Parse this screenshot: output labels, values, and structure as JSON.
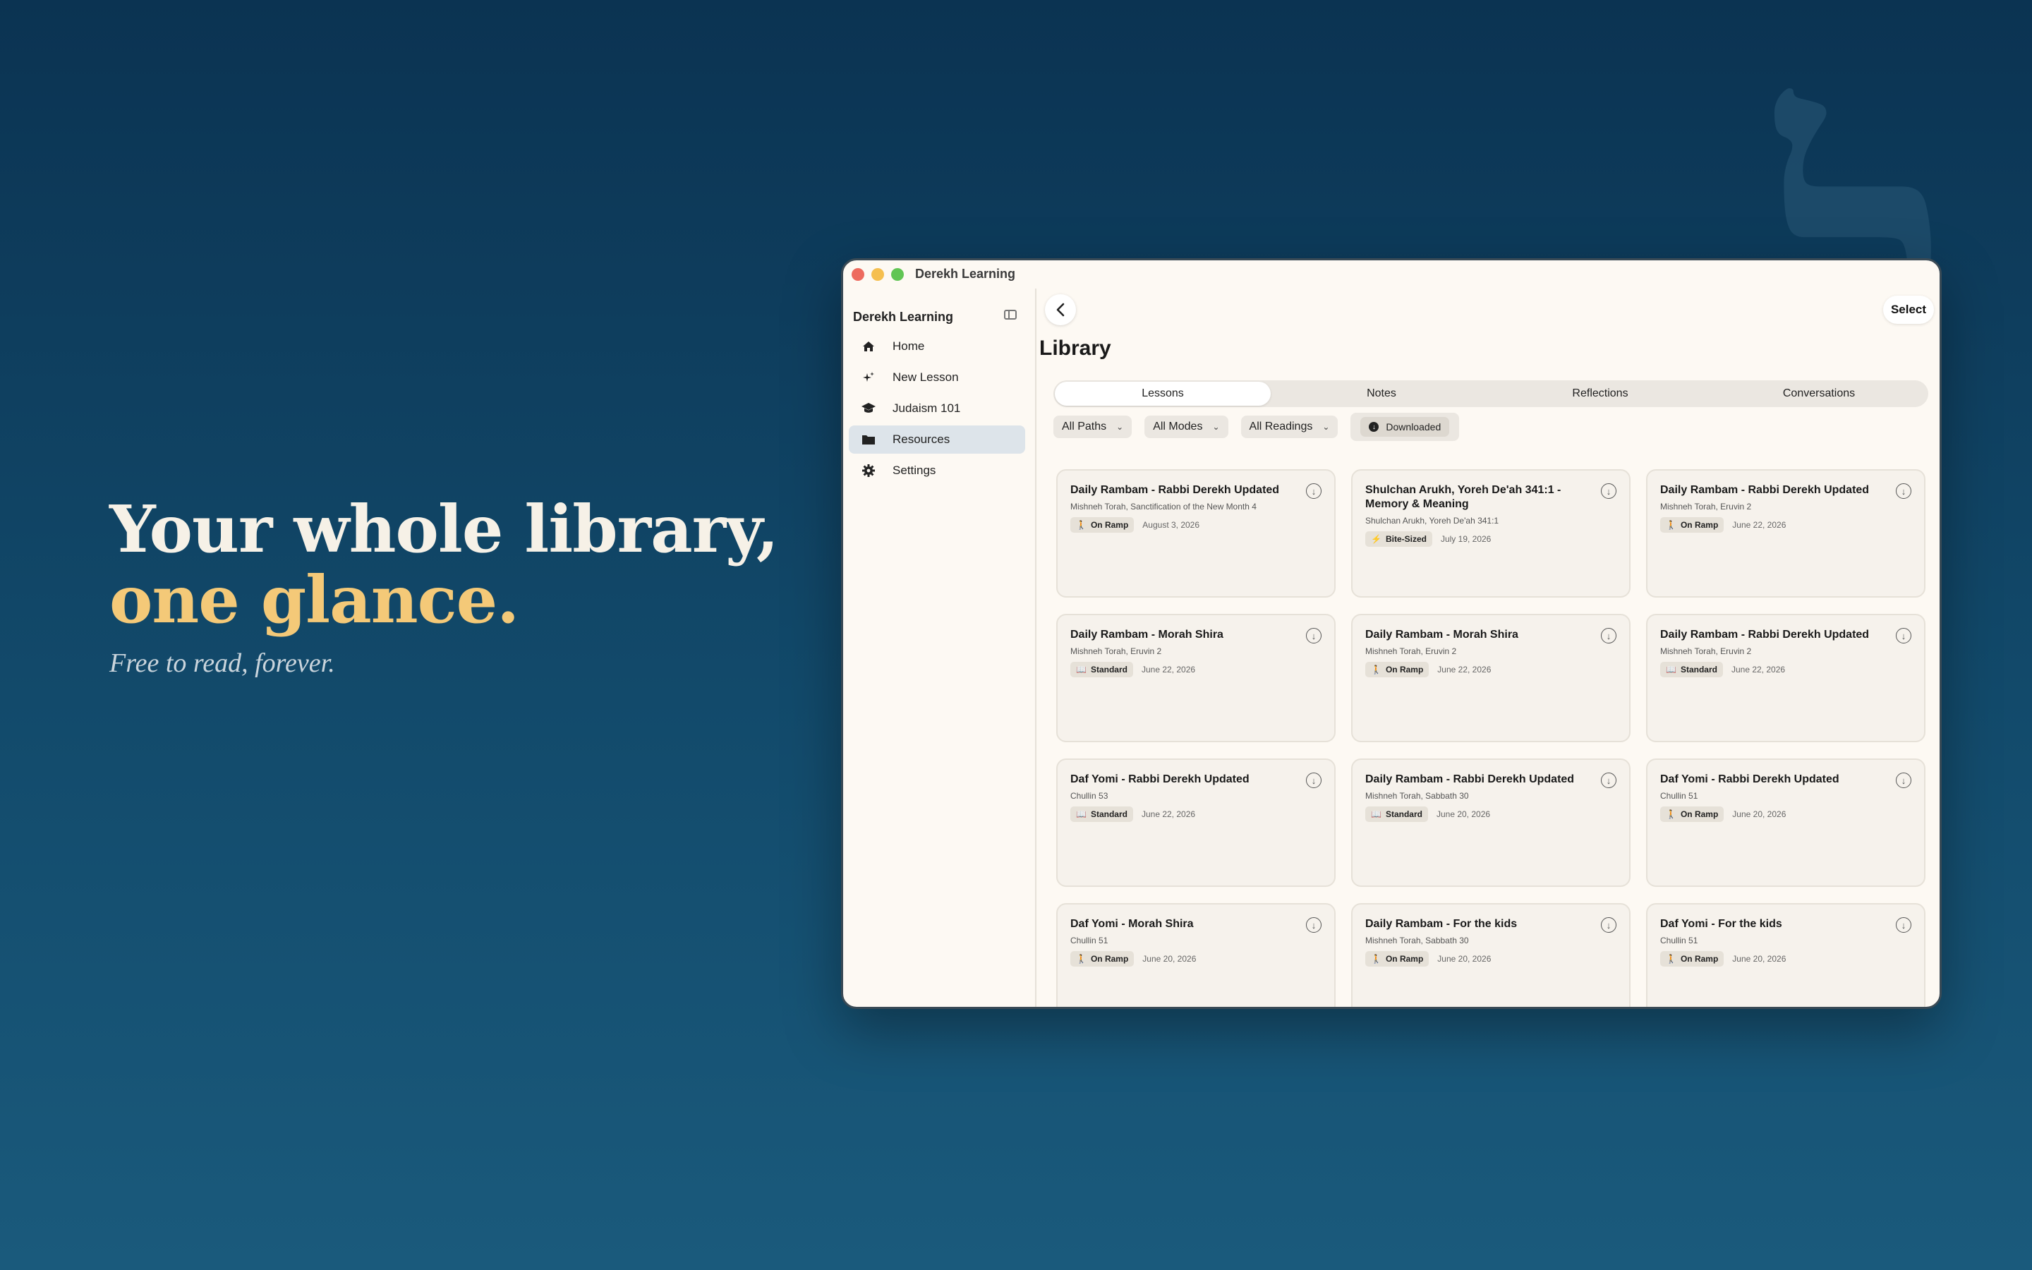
{
  "background_glyph": "ל",
  "hero": {
    "line1": "Your whole library,",
    "line2": "one glance.",
    "subtitle": "Free to read, forever."
  },
  "colors": {
    "accent_gold": "#f4c978",
    "background_top": "#0b3352",
    "background_bottom": "#1a5a7c",
    "window_bg": "#fdf9f3"
  },
  "window": {
    "title": "Derekh Learning"
  },
  "sidebar": {
    "title": "Derekh Learning",
    "items": [
      {
        "label": "Home",
        "icon": "house-icon",
        "active": false
      },
      {
        "label": "New Lesson",
        "icon": "sparkles-icon",
        "active": false
      },
      {
        "label": "Judaism 101",
        "icon": "graduation-cap-icon",
        "active": false
      },
      {
        "label": "Resources",
        "icon": "folder-icon",
        "active": true
      },
      {
        "label": "Settings",
        "icon": "gear-icon",
        "active": false
      }
    ]
  },
  "main": {
    "select_label": "Select",
    "page_title": "Library",
    "tabs": [
      {
        "label": "Lessons",
        "active": true
      },
      {
        "label": "Notes",
        "active": false
      },
      {
        "label": "Reflections",
        "active": false
      },
      {
        "label": "Conversations",
        "active": false
      }
    ],
    "filters": [
      "All Paths",
      "All Modes",
      "All Readings"
    ],
    "downloaded_label": "Downloaded"
  },
  "cards": [
    {
      "title": "Daily Rambam - Rabbi Derekh Updated",
      "subtitle": "Mishneh Torah, Sanctification of the New Month 4",
      "badge": "On Ramp",
      "date": "August 3, 2026"
    },
    {
      "title": "Shulchan Arukh, Yoreh De'ah 341:1 - Memory & Meaning",
      "subtitle": "Shulchan Arukh, Yoreh De'ah 341:1",
      "badge": "Bite-Sized",
      "date": "July 19, 2026"
    },
    {
      "title": "Daily Rambam - Rabbi Derekh Updated",
      "subtitle": "Mishneh Torah, Eruvin 2",
      "badge": "On Ramp",
      "date": "June 22, 2026"
    },
    {
      "title": "Daily Rambam - Morah Shira",
      "subtitle": "Mishneh Torah, Eruvin 2",
      "badge": "Standard",
      "date": "June 22, 2026"
    },
    {
      "title": "Daily Rambam - Morah Shira",
      "subtitle": "Mishneh Torah, Eruvin 2",
      "badge": "On Ramp",
      "date": "June 22, 2026"
    },
    {
      "title": "Daily Rambam - Rabbi Derekh Updated",
      "subtitle": "Mishneh Torah, Eruvin 2",
      "badge": "Standard",
      "date": "June 22, 2026"
    },
    {
      "title": "Daf Yomi - Rabbi Derekh Updated",
      "subtitle": "Chullin 53",
      "badge": "Standard",
      "date": "June 22, 2026"
    },
    {
      "title": "Daily Rambam - Rabbi Derekh Updated",
      "subtitle": "Mishneh Torah, Sabbath 30",
      "badge": "Standard",
      "date": "June 20, 2026"
    },
    {
      "title": "Daf Yomi - Rabbi Derekh Updated",
      "subtitle": "Chullin 51",
      "badge": "On Ramp",
      "date": "June 20, 2026"
    },
    {
      "title": "Daf Yomi - Morah Shira",
      "subtitle": "Chullin 51",
      "badge": "On Ramp",
      "date": "June 20, 2026"
    },
    {
      "title": "Daily Rambam - For the kids",
      "subtitle": "Mishneh Torah, Sabbath 30",
      "badge": "On Ramp",
      "date": "June 20, 2026"
    },
    {
      "title": "Daf Yomi - For the kids",
      "subtitle": "Chullin 51",
      "badge": "On Ramp",
      "date": "June 20, 2026"
    }
  ]
}
